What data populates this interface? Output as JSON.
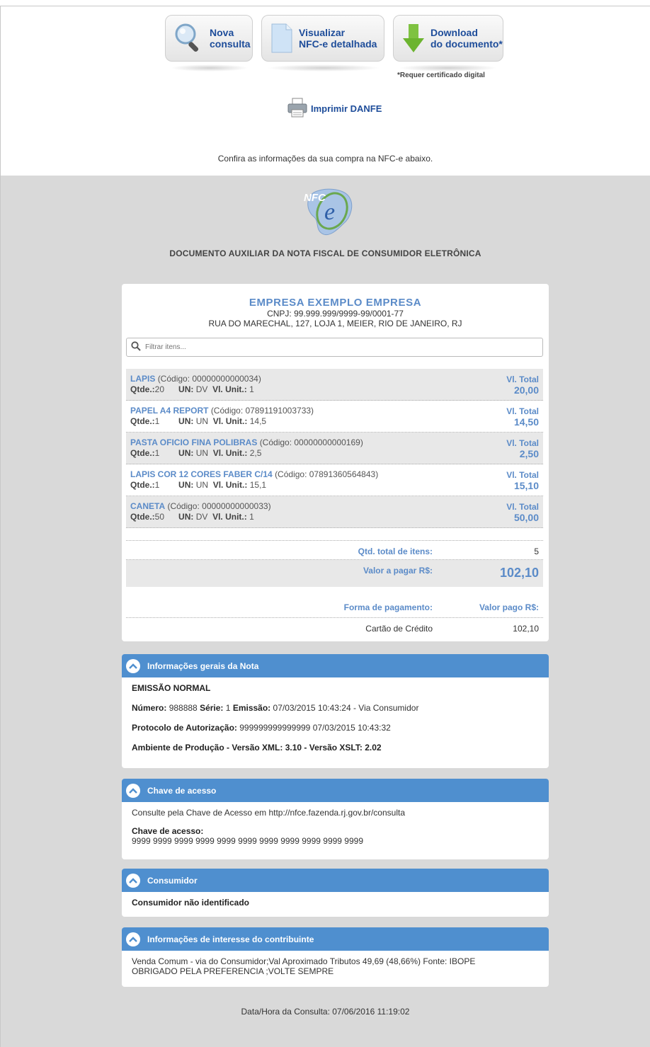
{
  "toolbar": {
    "nova_consulta": [
      "Nova",
      "consulta"
    ],
    "visualizar": [
      "Visualizar",
      "NFC-e detalhada"
    ],
    "download": [
      "Download",
      "do documento*"
    ],
    "cert_note": "*Requer certificado digital",
    "print_label": "Imprimir DANFE",
    "confira": "Confira as informações da sua compra na NFC-e abaixo."
  },
  "logo": {
    "text": "NFC-e"
  },
  "doc_title": "DOCUMENTO AUXILIAR DA NOTA FISCAL DE CONSUMIDOR ELETRÔNICA",
  "company": {
    "name": "EMPRESA EXEMPLO EMPRESA",
    "cnpj": "CNPJ: 99.999.999/9999-99/0001-77",
    "address": "RUA DO MARECHAL, 127, LOJA 1, MEIER, RIO DE JANEIRO, RJ"
  },
  "filter": {
    "placeholder": "Filtrar itens..."
  },
  "items": [
    {
      "name": "LAPIS",
      "code": "(Código: 00000000000034)",
      "qtde_label": "Qtde.:",
      "qtde": "20",
      "un_label": "UN:",
      "un": "DV",
      "vlunit_label": "Vl. Unit.:",
      "vlunit": "1",
      "total_label": "Vl. Total",
      "total": "20,00"
    },
    {
      "name": "PAPEL A4 REPORT",
      "code": "(Código: 07891191003733)",
      "qtde_label": "Qtde.:",
      "qtde": "1",
      "un_label": "UN:",
      "un": "UN",
      "vlunit_label": "Vl. Unit.:",
      "vlunit": "14,5",
      "total_label": "Vl. Total",
      "total": "14,50"
    },
    {
      "name": "PASTA OFICIO FINA POLIBRAS",
      "code": "(Código: 00000000000169)",
      "qtde_label": "Qtde.:",
      "qtde": "1",
      "un_label": "UN:",
      "un": "UN",
      "vlunit_label": "Vl. Unit.:",
      "vlunit": "2,5",
      "total_label": "Vl. Total",
      "total": "2,50"
    },
    {
      "name": "LAPIS COR 12 CORES FABER C/14",
      "code": "(Código: 07891360564843)",
      "qtde_label": "Qtde.:",
      "qtde": "1",
      "un_label": "UN:",
      "un": "UN",
      "vlunit_label": "Vl. Unit.:",
      "vlunit": "15,1",
      "total_label": "Vl. Total",
      "total": "15,10"
    },
    {
      "name": "CANETA",
      "code": "(Código: 00000000000033)",
      "qtde_label": "Qtde.:",
      "qtde": "50",
      "un_label": "UN:",
      "un": "DV",
      "vlunit_label": "Vl. Unit.:",
      "vlunit": "1",
      "total_label": "Vl. Total",
      "total": "50,00"
    }
  ],
  "totals": {
    "qtd_label": "Qtd. total de itens:",
    "qtd_value": "5",
    "valor_label": "Valor a pagar R$:",
    "valor_value": "102,10",
    "forma_label": "Forma de pagamento:",
    "pago_label": "Valor pago R$:",
    "forma_value": "Cartão de Crédito",
    "pago_value": "102,10"
  },
  "sections": {
    "gerais": {
      "title": "Informações gerais da Nota",
      "emissao": "EMISSÃO NORMAL",
      "numero_label": "Número:",
      "numero": "988888",
      "serie_label": "Série:",
      "serie": "1",
      "emissao_label": "Emissão:",
      "emissao_value": "07/03/2015 10:43:24 - Via Consumidor",
      "protocolo_label": "Protocolo de Autorização:",
      "protocolo_value": "999999999999999 07/03/2015 10:43:32",
      "ambiente": "Ambiente de Produção - Versão XML: 3.10 - Versão XSLT: 2.02"
    },
    "chave": {
      "title": "Chave de acesso",
      "consulte": "Consulte pela Chave de Acesso em http://nfce.fazenda.rj.gov.br/consulta",
      "chave_label": "Chave de acesso:",
      "chave_value": "9999 9999 9999 9999 9999 9999 9999 9999 9999 9999 9999"
    },
    "consumidor": {
      "title": "Consumidor",
      "text": "Consumidor não identificado"
    },
    "contribuinte": {
      "title": "Informações de interesse do contribuinte",
      "line1": "Venda Comum - via do Consumidor;Val Aproximado Tributos 49,69 (48,66%) Fonte: IBOPE",
      "line2": "OBRIGADO PELA PREFERENCIA ;VOLTE SEMPRE"
    }
  },
  "footer": {
    "timestamp": "Data/Hora da Consulta: 07/06/2016 11:19:02"
  },
  "colors": {
    "accent": "#4f8fcf",
    "link": "#1e4d9a",
    "item_blue": "#5b8bc8",
    "background": "#d9d9d9"
  },
  "icons": [
    "magnifier-icon",
    "document-icon",
    "download-arrow-icon",
    "printer-icon",
    "search-icon",
    "chevron-up-icon"
  ]
}
